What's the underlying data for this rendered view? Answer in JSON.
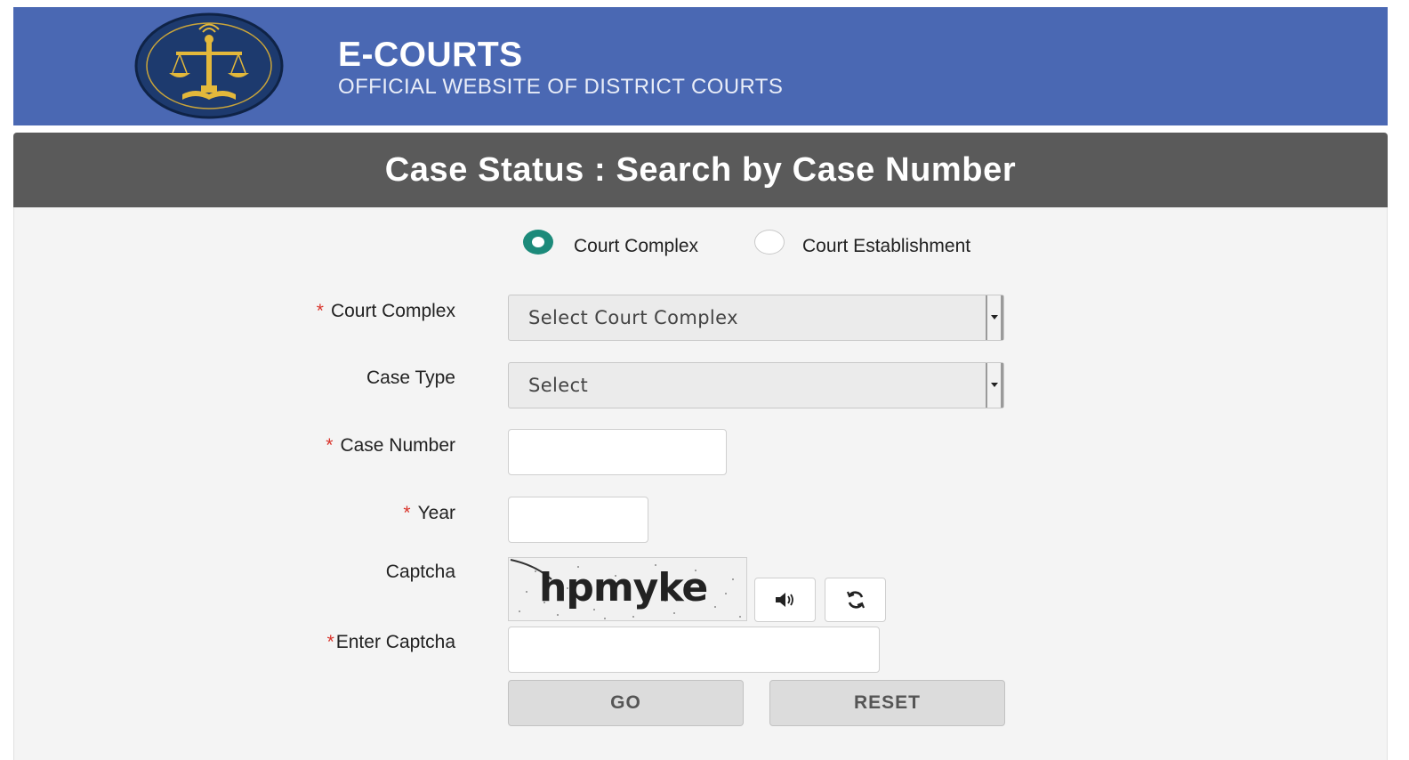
{
  "header": {
    "title": "E-COURTS",
    "subtitle": "OFFICIAL WEBSITE OF DISTRICT COURTS"
  },
  "page_title": "Case Status : Search by Case Number",
  "search_mode": {
    "options": [
      "Court Complex",
      "Court Establishment"
    ],
    "selected": "Court Complex"
  },
  "form": {
    "court_complex": {
      "label": "Court Complex",
      "required": true,
      "value": "Select Court Complex"
    },
    "case_type": {
      "label": "Case Type",
      "required": false,
      "value": "Select"
    },
    "case_number": {
      "label": "Case Number",
      "required": true,
      "value": ""
    },
    "year": {
      "label": "Year",
      "required": true,
      "value": ""
    },
    "captcha": {
      "label": "Captcha",
      "text": "hpmyke"
    },
    "enter_captcha": {
      "label": "Enter Captcha",
      "required": true,
      "value": ""
    },
    "required_marker": "*"
  },
  "buttons": {
    "go": "GO",
    "reset": "RESET"
  },
  "icons": {
    "logo": "ecourts-emblem-icon",
    "audio": "speaker-icon",
    "refresh": "refresh-icon"
  },
  "colors": {
    "header_bg": "#4a68b3",
    "title_bar_bg": "#5a5a5a",
    "radio_checked": "#1c8a7a",
    "required_marker": "#d9342b"
  }
}
